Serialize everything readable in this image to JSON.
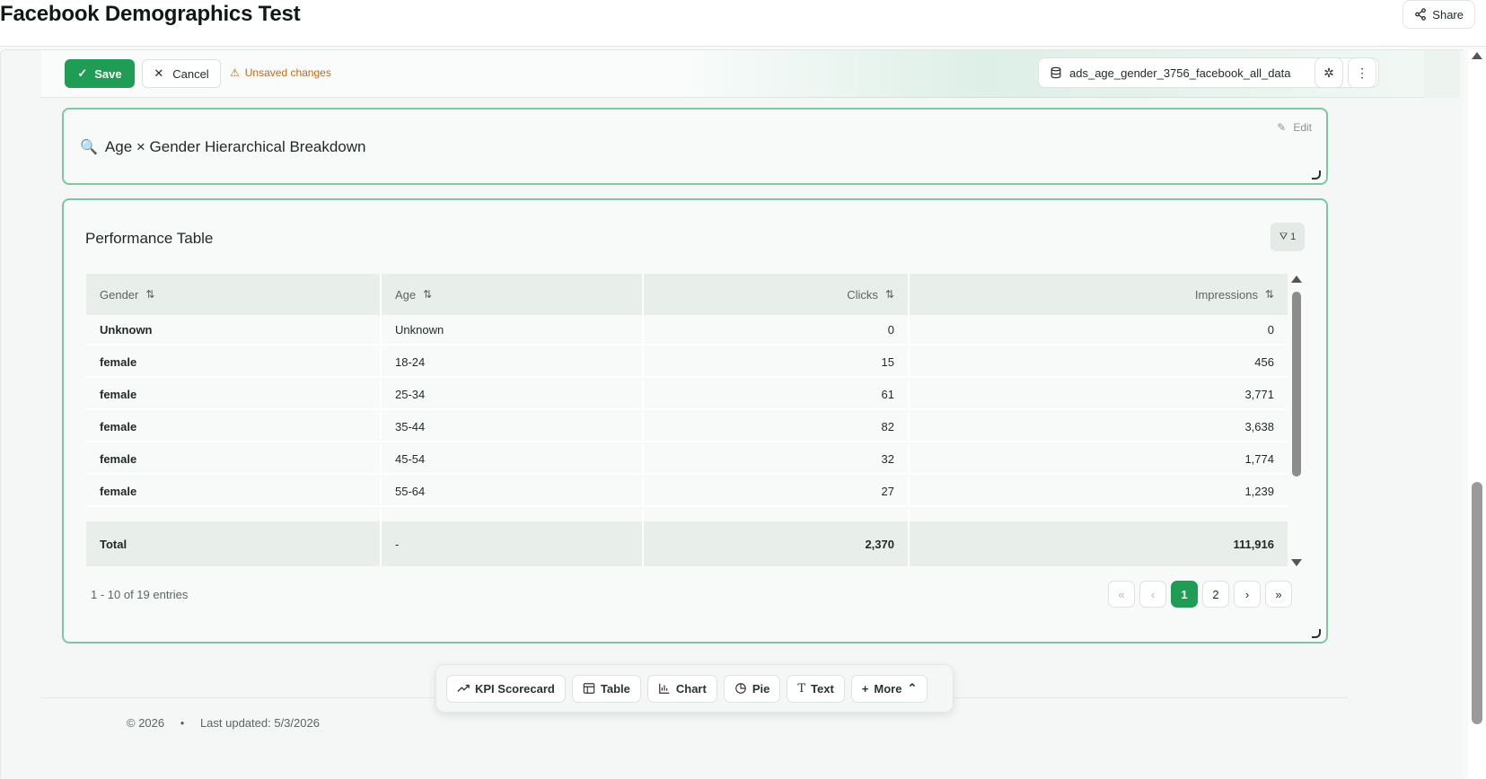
{
  "header": {
    "title": "Facebook Demographics Test",
    "share_label": "Share"
  },
  "editbar": {
    "save_label": "Save",
    "cancel_label": "Cancel",
    "unsaved_label": "Unsaved changes",
    "datasource": "ads_age_gender_3756_facebook_all_data"
  },
  "title_widget": {
    "icon": "magnifier-emoji",
    "text": "Age × Gender Hierarchical Breakdown",
    "edit_label": "Edit"
  },
  "table_widget": {
    "title": "Performance Table",
    "filter_count": "1",
    "columns": [
      "Gender",
      "Age",
      "Clicks",
      "Impressions"
    ],
    "rows": [
      {
        "gender": "Unknown",
        "age": "Unknown",
        "clicks": "0",
        "impressions": "0"
      },
      {
        "gender": "female",
        "age": "18-24",
        "clicks": "15",
        "impressions": "456"
      },
      {
        "gender": "female",
        "age": "25-34",
        "clicks": "61",
        "impressions": "3,771"
      },
      {
        "gender": "female",
        "age": "35-44",
        "clicks": "82",
        "impressions": "3,638"
      },
      {
        "gender": "female",
        "age": "45-54",
        "clicks": "32",
        "impressions": "1,774"
      },
      {
        "gender": "female",
        "age": "55-64",
        "clicks": "27",
        "impressions": "1,239"
      }
    ],
    "total": {
      "gender": "Total",
      "age": "-",
      "clicks": "2,370",
      "impressions": "111,916"
    },
    "entries_text": "1 - 10 of 19 entries",
    "pages": [
      "1",
      "2"
    ],
    "current_page": "1"
  },
  "add_toolbar": {
    "items": [
      "KPI Scorecard",
      "Table",
      "Chart",
      "Pie",
      "Text",
      "More"
    ]
  },
  "footer": {
    "copyright": "© 2026",
    "bullet": "•",
    "updated": "Last updated: 5/3/2026"
  },
  "colors": {
    "accent": "#1f9d55",
    "widget_border": "#7cc9a0",
    "warning": "#c26a17"
  }
}
